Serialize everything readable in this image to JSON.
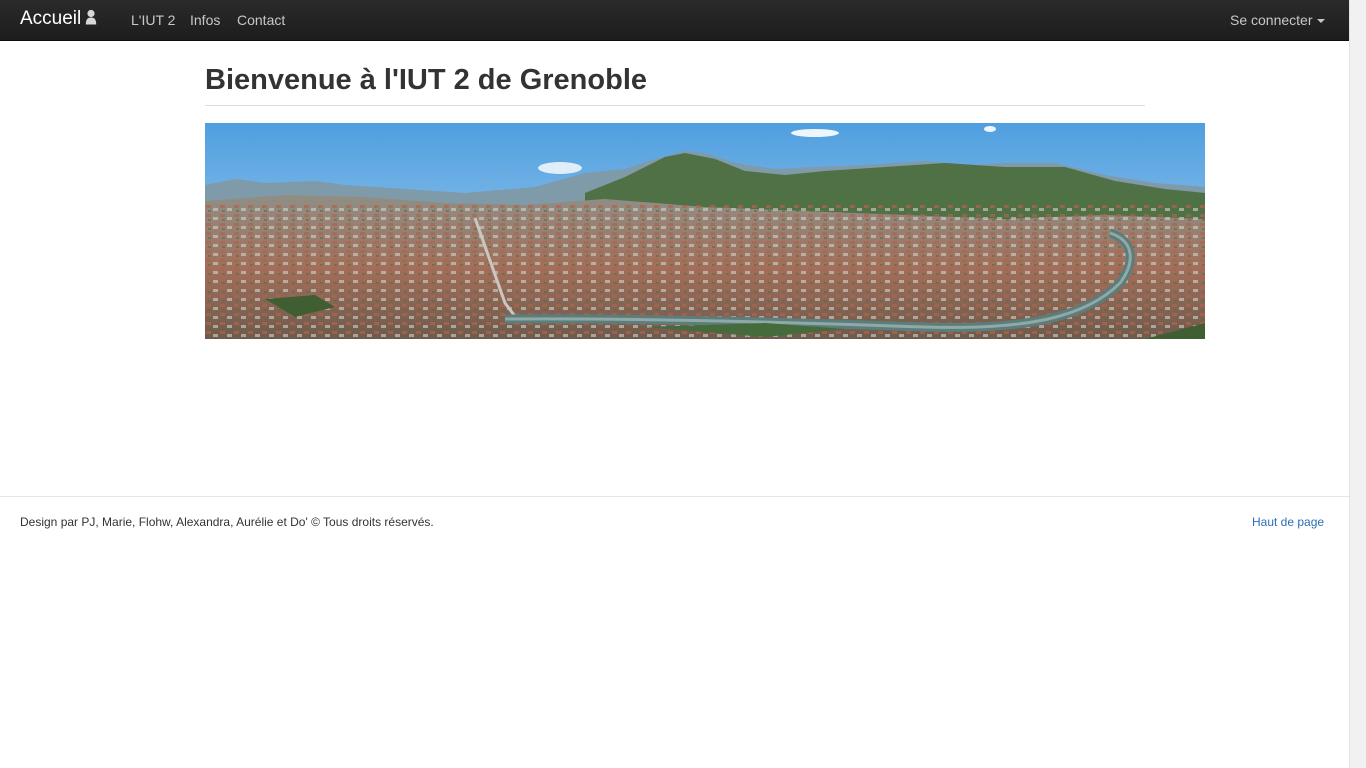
{
  "navbar": {
    "brand": "Accueil",
    "brand_icon": "user-icon",
    "links": [
      "L'IUT 2",
      "Infos",
      "Contact"
    ],
    "login": "Se connecter",
    "login_icon": "caret-down-icon"
  },
  "main": {
    "title": "Bienvenue à l'IUT 2 de Grenoble",
    "image_alt": "Panorama de Grenoble"
  },
  "footer": {
    "credits": "Design par PJ, Marie, Flohw, Alexandra, Aurélie et Do' © Tous droits réservés.",
    "top_link": "Haut de page"
  },
  "colors": {
    "navbar": "#222222",
    "link": "#2a6fb8",
    "text": "#333333"
  }
}
